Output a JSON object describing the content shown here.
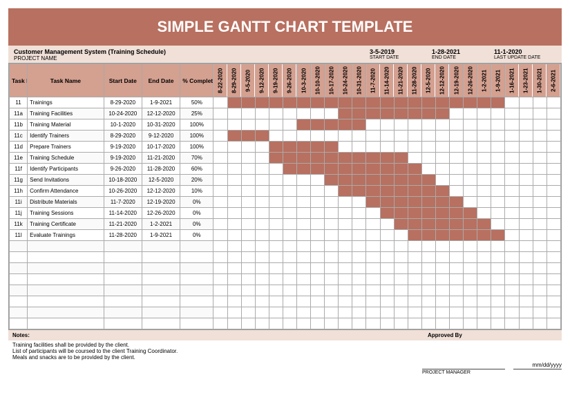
{
  "title": "SIMPLE GANTT CHART TEMPLATE",
  "header": {
    "project_name": "Customer Management System (Training Schedule)",
    "project_label": "PROJECT NAME",
    "start_date": "3-5-2019",
    "start_label": "START DATE",
    "end_date": "1-28-2021",
    "end_label": "END DATE",
    "last_update": "11-1-2020",
    "last_update_label": "LAST UPDATE DATE"
  },
  "columns": {
    "id": "Task ID",
    "name": "Task Name",
    "start": "Start Date",
    "end": "End Date",
    "pct": "% Completed"
  },
  "dates": [
    "8-22-2020",
    "8-29-2020",
    "9-5-2020",
    "9-12-2020",
    "9-19-2020",
    "9-26-2020",
    "10-3-2020",
    "10-10-2020",
    "10-17-2020",
    "10-24-2020",
    "10-31-2020",
    "11-7-2020",
    "11-14-2020",
    "11-21-2020",
    "11-28-2020",
    "12-5-2020",
    "12-12-2020",
    "12-19-2020",
    "12-26-2020",
    "1-2-2021",
    "1-9-2021",
    "1-16-2021",
    "1-23-2021",
    "1-30-2021",
    "2-6-2021"
  ],
  "tasks": [
    {
      "id": "11",
      "name": "Trainings",
      "start": "8-29-2020",
      "end": "1-9-2021",
      "pct": "50%",
      "bar": [
        1,
        20
      ]
    },
    {
      "id": "11a",
      "name": "Training Facilities",
      "start": "10-24-2020",
      "end": "12-12-2020",
      "pct": "25%",
      "bar": [
        9,
        16
      ]
    },
    {
      "id": "11b",
      "name": "Training Material",
      "start": "10-1-2020",
      "end": "10-31-2020",
      "pct": "100%",
      "bar": [
        6,
        10
      ]
    },
    {
      "id": "11c",
      "name": "Identify Trainers",
      "start": "8-29-2020",
      "end": "9-12-2020",
      "pct": "100%",
      "bar": [
        1,
        3
      ]
    },
    {
      "id": "11d",
      "name": "Prepare Trainers",
      "start": "9-19-2020",
      "end": "10-17-2020",
      "pct": "100%",
      "bar": [
        4,
        8
      ]
    },
    {
      "id": "11e",
      "name": "Training Schedule",
      "start": "9-19-2020",
      "end": "11-21-2020",
      "pct": "70%",
      "bar": [
        4,
        13
      ]
    },
    {
      "id": "11f",
      "name": "Identify Participants",
      "start": "9-26-2020",
      "end": "11-28-2020",
      "pct": "60%",
      "bar": [
        5,
        14
      ]
    },
    {
      "id": "11g",
      "name": "Send Invitations",
      "start": "10-18-2020",
      "end": "12-5-2020",
      "pct": "20%",
      "bar": [
        8,
        15
      ]
    },
    {
      "id": "11h",
      "name": "Confirm Attendance",
      "start": "10-26-2020",
      "end": "12-12-2020",
      "pct": "10%",
      "bar": [
        9,
        16
      ]
    },
    {
      "id": "11i",
      "name": "Distribute Materials",
      "start": "11-7-2020",
      "end": "12-19-2020",
      "pct": "0%",
      "bar": [
        11,
        17
      ]
    },
    {
      "id": "11j",
      "name": "Training Sessions",
      "start": "11-14-2020",
      "end": "12-26-2020",
      "pct": "0%",
      "bar": [
        12,
        18
      ]
    },
    {
      "id": "11k",
      "name": "Training Certificate",
      "start": "11-21-2020",
      "end": "1-2-2021",
      "pct": "0%",
      "bar": [
        13,
        19
      ]
    },
    {
      "id": "11l",
      "name": "Evaluate Trainings",
      "start": "11-28-2020",
      "end": "1-9-2021",
      "pct": "0%",
      "bar": [
        14,
        20
      ]
    }
  ],
  "empty_rows": 8,
  "footer": {
    "notes_h": "Notes:",
    "notes": [
      "Training facilities shall be provided by the client.",
      "List of participants will be coursed to the client Training Coordinator.",
      "Meals and snacks are to be provided by the client."
    ],
    "approved_h": "Approved By",
    "pm_label": "PROJECT MANAGER",
    "date_placeholder": "mm/dd/yyyy"
  },
  "chart_data": {
    "type": "gantt",
    "title": "SIMPLE GANTT CHART TEMPLATE",
    "x_categories_weeks_starting": [
      "8-22-2020",
      "8-29-2020",
      "9-5-2020",
      "9-12-2020",
      "9-19-2020",
      "9-26-2020",
      "10-3-2020",
      "10-10-2020",
      "10-17-2020",
      "10-24-2020",
      "10-31-2020",
      "11-7-2020",
      "11-14-2020",
      "11-21-2020",
      "11-28-2020",
      "12-5-2020",
      "12-12-2020",
      "12-19-2020",
      "12-26-2020",
      "1-2-2021",
      "1-9-2021",
      "1-16-2021",
      "1-23-2021",
      "1-30-2021",
      "2-6-2021"
    ],
    "tasks": [
      {
        "id": "11",
        "name": "Trainings",
        "start": "8-29-2020",
        "end": "1-9-2021",
        "pct_complete": 50
      },
      {
        "id": "11a",
        "name": "Training Facilities",
        "start": "10-24-2020",
        "end": "12-12-2020",
        "pct_complete": 25
      },
      {
        "id": "11b",
        "name": "Training Material",
        "start": "10-1-2020",
        "end": "10-31-2020",
        "pct_complete": 100
      },
      {
        "id": "11c",
        "name": "Identify Trainers",
        "start": "8-29-2020",
        "end": "9-12-2020",
        "pct_complete": 100
      },
      {
        "id": "11d",
        "name": "Prepare Trainers",
        "start": "9-19-2020",
        "end": "10-17-2020",
        "pct_complete": 100
      },
      {
        "id": "11e",
        "name": "Training Schedule",
        "start": "9-19-2020",
        "end": "11-21-2020",
        "pct_complete": 70
      },
      {
        "id": "11f",
        "name": "Identify Participants",
        "start": "9-26-2020",
        "end": "11-28-2020",
        "pct_complete": 60
      },
      {
        "id": "11g",
        "name": "Send Invitations",
        "start": "10-18-2020",
        "end": "12-5-2020",
        "pct_complete": 20
      },
      {
        "id": "11h",
        "name": "Confirm Attendance",
        "start": "10-26-2020",
        "end": "12-12-2020",
        "pct_complete": 10
      },
      {
        "id": "11i",
        "name": "Distribute Materials",
        "start": "11-7-2020",
        "end": "12-19-2020",
        "pct_complete": 0
      },
      {
        "id": "11j",
        "name": "Training Sessions",
        "start": "11-14-2020",
        "end": "12-26-2020",
        "pct_complete": 0
      },
      {
        "id": "11k",
        "name": "Training Certificate",
        "start": "11-21-2020",
        "end": "1-2-2021",
        "pct_complete": 0
      },
      {
        "id": "11l",
        "name": "Evaluate Trainings",
        "start": "11-28-2020",
        "end": "1-9-2021",
        "pct_complete": 0
      }
    ],
    "project_start": "3-5-2019",
    "project_end": "1-28-2021",
    "last_update": "11-1-2020"
  }
}
